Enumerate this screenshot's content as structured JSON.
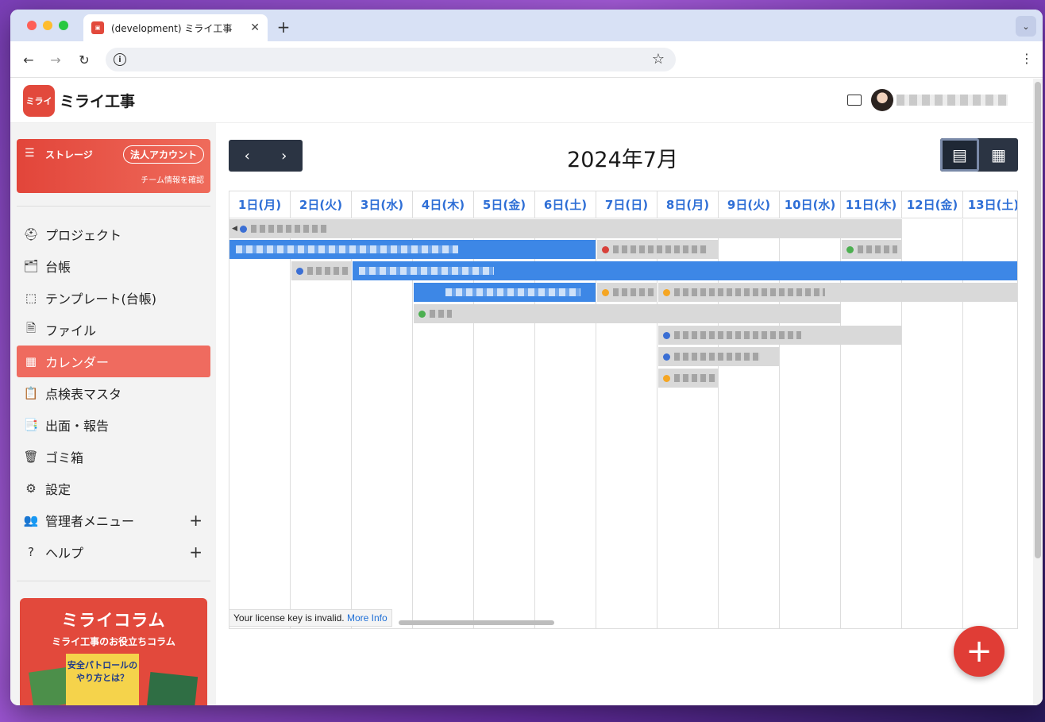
{
  "browser": {
    "tab_title": "(development) ミライ工事",
    "new_tab": "+",
    "tab_close": "✕",
    "menu_chevron": "⌄"
  },
  "app": {
    "logo_mark": "ミライ",
    "logo_text": "ミライ工事"
  },
  "storage": {
    "label": "ストレージ",
    "badge": "法人アカウント",
    "team_link": "チーム情報を確認"
  },
  "sidebar": {
    "items": [
      {
        "label": "プロジェクト",
        "icon": "project-icon",
        "glyph": "⛑"
      },
      {
        "label": "台帳",
        "icon": "ledger-icon",
        "glyph": "🗂"
      },
      {
        "label": "テンプレート(台帳)",
        "icon": "template-icon",
        "glyph": "⬚"
      },
      {
        "label": "ファイル",
        "icon": "file-icon",
        "glyph": "🗎"
      },
      {
        "label": "カレンダー",
        "icon": "calendar-icon",
        "glyph": "▦"
      },
      {
        "label": "点検表マスタ",
        "icon": "checklist-icon",
        "glyph": "📋"
      },
      {
        "label": "出面・報告",
        "icon": "report-icon",
        "glyph": "📑"
      },
      {
        "label": "ゴミ箱",
        "icon": "trash-icon",
        "glyph": "🗑"
      },
      {
        "label": "設定",
        "icon": "gear-icon",
        "glyph": "⚙"
      },
      {
        "label": "管理者メニュー",
        "icon": "admin-icon",
        "glyph": "👥"
      },
      {
        "label": "ヘルプ",
        "icon": "help-icon",
        "glyph": "?"
      }
    ],
    "plus": "+"
  },
  "column": {
    "title": "ミライコラム",
    "subtitle": "ミライ工事のお役立ちコラム",
    "book_title": "安全パトロールのやり方とは？"
  },
  "calendar": {
    "title": "2024年7月",
    "prev": "‹",
    "next": "›",
    "days": [
      "1日(月)",
      "2日(火)",
      "3日(水)",
      "4日(木)",
      "5日(金)",
      "6日(土)",
      "7日(日)",
      "8日(月)",
      "9日(火)",
      "10日(水)",
      "11日(木)",
      "12日(金)",
      "13日(土)"
    ]
  },
  "license": {
    "text": "Your license key is invalid.",
    "link": "More Info"
  },
  "fab": "+",
  "colors": {
    "accent": "#e2493c",
    "event_blue": "#3d87e6",
    "event_gray": "#d9d9d9",
    "header_text": "#2f6fd6",
    "nav_dark": "#2b3443",
    "dot_blue": "#3b6fd4",
    "dot_red": "#d8413a",
    "dot_green": "#4caf50",
    "dot_orange": "#f5a623"
  }
}
